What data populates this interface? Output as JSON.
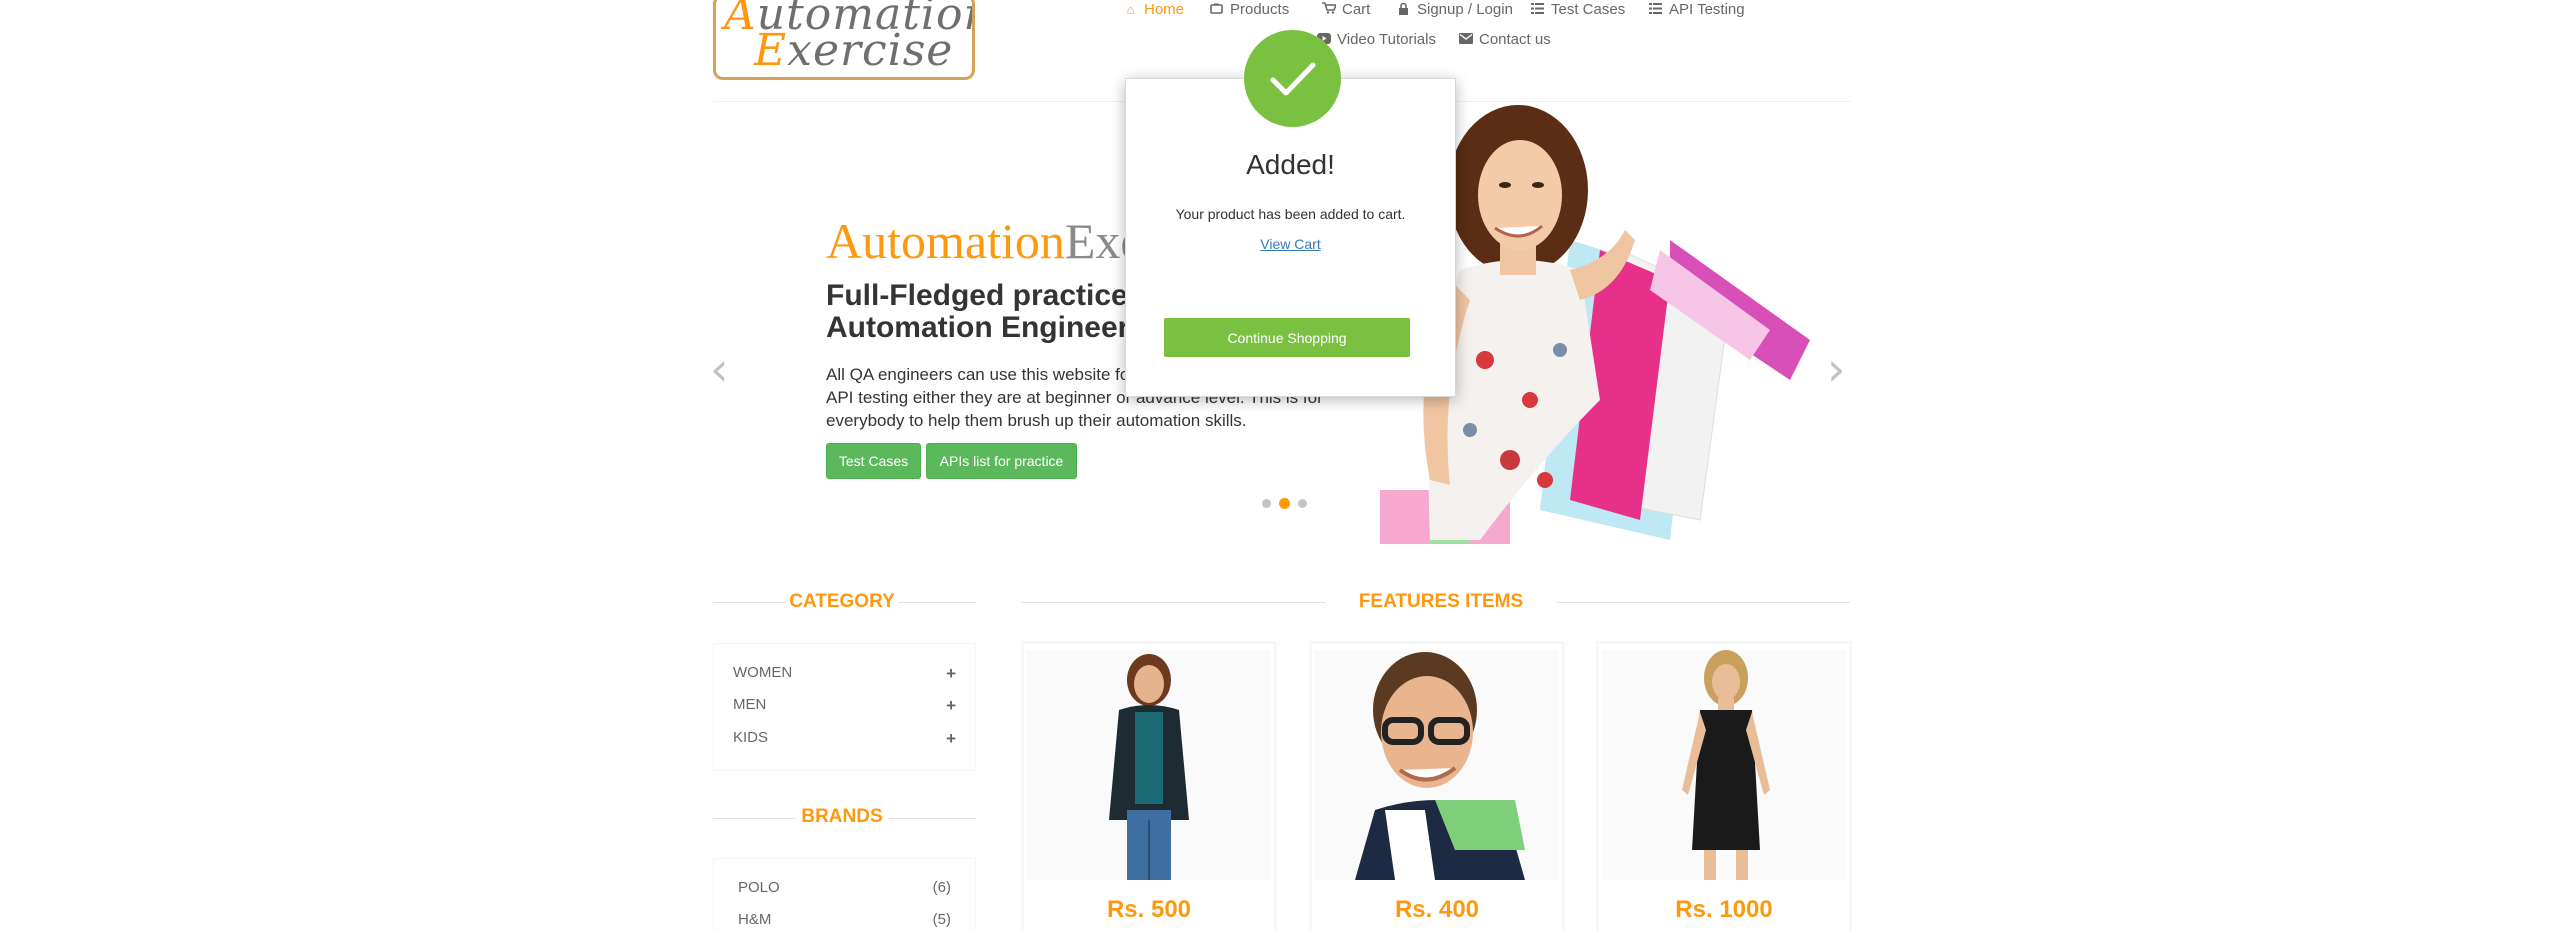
{
  "logo": {
    "line1_cap": "A",
    "line1_rest": "utomation",
    "line2_cap": "E",
    "line2_rest": "xercise"
  },
  "nav": [
    {
      "label": "Home",
      "icon": "home-icon"
    },
    {
      "label": "Products",
      "icon": "shirt-icon"
    },
    {
      "label": "Cart",
      "icon": "cart-icon"
    },
    {
      "label": "Signup / Login",
      "icon": "lock-icon"
    },
    {
      "label": "Test Cases",
      "icon": "list-icon"
    },
    {
      "label": "API Testing",
      "icon": "list-icon"
    },
    {
      "label": "Video Tutorials",
      "icon": "youtube-icon"
    },
    {
      "label": "Contact us",
      "icon": "envelope-icon"
    }
  ],
  "hero": {
    "brand_a": "Automation",
    "brand_b": "Exe",
    "headline_1": "Full-Fledged practice w",
    "headline_2": "Automation Engineers",
    "para_1": "All QA engineers can use this website for",
    "para_2": "API testing either they are at beginner or advance level. This is for",
    "para_3": "everybody to help them brush up their automation skills.",
    "btn_test_cases": "Test Cases",
    "btn_apis": "APIs list for practice",
    "active_slide": 2,
    "slide_count": 3
  },
  "category": {
    "title": "CATEGORY",
    "items": [
      {
        "label": "WOMEN",
        "icon": "plus-icon"
      },
      {
        "label": "MEN",
        "icon": "plus-icon"
      },
      {
        "label": "KIDS",
        "icon": "plus-icon"
      }
    ]
  },
  "brands": {
    "title": "BRANDS",
    "items": [
      {
        "label": "POLO",
        "count": "(6)"
      },
      {
        "label": "H&M",
        "count": "(5)"
      }
    ]
  },
  "features": {
    "title": "FEATURES ITEMS",
    "products": [
      {
        "price": "Rs. 500"
      },
      {
        "price": "Rs. 400"
      },
      {
        "price": "Rs. 1000"
      }
    ]
  },
  "modal": {
    "title": "Added!",
    "message": "Your product has been added to cart.",
    "link": "View Cart",
    "button": "Continue Shopping"
  },
  "colors": {
    "accent": "#fe980f",
    "green": "#5cb85c",
    "modal_green": "#7ac142",
    "link": "#337ab7"
  }
}
